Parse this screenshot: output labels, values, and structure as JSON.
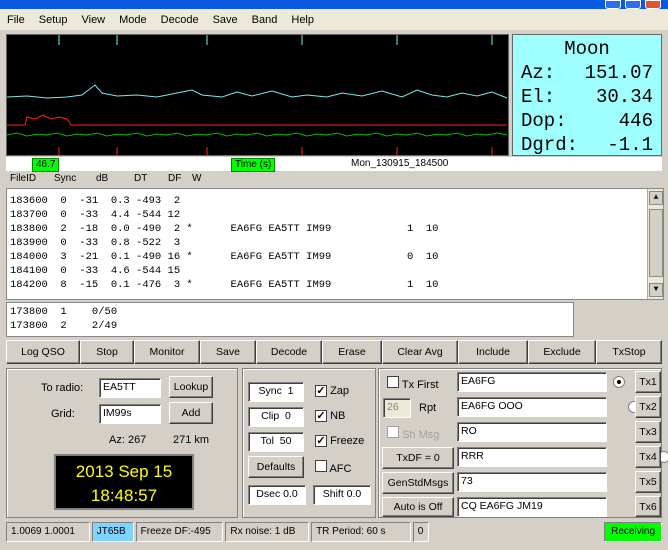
{
  "menu": [
    "File",
    "Setup",
    "View",
    "Mode",
    "Decode",
    "Save",
    "Band",
    "Help"
  ],
  "moon": {
    "title": "Moon",
    "az_label": "Az:",
    "az": "151.07",
    "el_label": "El:",
    "el": "30.34",
    "dop_label": "Dop:",
    "dop": "446",
    "dgrd_label": "Dgrd:",
    "dgrd": "-1.1"
  },
  "scale": {
    "left_value": "46.7",
    "time_label": "Time (s)",
    "filename": "Mon_130915_184500"
  },
  "decode_header": {
    "fileid": "FileID",
    "sync": "Sync",
    "db": "dB",
    "dt": "DT",
    "df": "DF",
    "w": "W"
  },
  "decode_lines": [
    "183600  0  -31  0.3 -493  2",
    "183700  0  -33  4.4 -544 12",
    "183800  2  -18  0.0 -490  2 *      EA6FG EA5TT IM99            1  10",
    "183900  0  -33  0.8 -522  3",
    "184000  3  -21  0.1 -490 16 *      EA6FG EA5TT IM99            0  10",
    "184100  0  -33  4.6 -544 15",
    "184200  8  -15  0.1 -476  3 *      EA6FG EA5TT IM99            1  10"
  ],
  "avg_lines": [
    "173800  1    0/50",
    "173800  2    2/49"
  ],
  "buttons": [
    "Log QSO",
    "Stop",
    "Monitor",
    "Save",
    "Decode",
    "Erase",
    "Clear Avg",
    "Include",
    "Exclude",
    "TxStop"
  ],
  "radio": {
    "to_radio_label": "To radio:",
    "to_radio_value": "EA5TT",
    "grid_label": "Grid:",
    "grid_value": "IM99s",
    "lookup": "Lookup",
    "add": "Add",
    "az": "Az: 267",
    "km": "271 km"
  },
  "clock": {
    "date": "2013 Sep 15",
    "time": "18:48:57"
  },
  "controls": {
    "sync_label": "Sync",
    "sync": "1",
    "clip_label": "Clip",
    "clip": "0",
    "tol_label": "Tol",
    "tol": "50",
    "defaults": "Defaults",
    "dsec": "Dsec  0.0",
    "shift": "Shift 0.0",
    "zap": "Zap",
    "nb": "NB",
    "freeze": "Freeze",
    "afc": "AFC"
  },
  "tx": {
    "tx_first": "Tx First",
    "rpt_value": "26",
    "rpt_label": "Rpt",
    "sh_msg": "Sh Msg",
    "txdf": "TxDF = 0",
    "gen": "GenStdMsgs",
    "auto": "Auto is Off",
    "messages": [
      "EA6FG",
      "EA6FG OOO",
      "RO",
      "RRR",
      "73",
      "CQ EA6FG JM19"
    ],
    "tx_buttons": [
      "Tx1",
      "Tx2",
      "Tx3",
      "Tx4",
      "Tx5",
      "Tx6"
    ]
  },
  "status": {
    "freq": "1.0069 1.0001",
    "mode": "JT65B",
    "freeze": "Freeze DF:-495",
    "rxnoise": "Rx noise:  1 dB",
    "trperiod": "TR Period: 60 s",
    "zero": "0",
    "receiving": "Receiving"
  },
  "colors": {
    "moon_bg": "#9fffff",
    "graph_bg": "#000000",
    "trace_cyan": "#7fe8e8",
    "trace_green": "#00c000",
    "trace_red": "#ff2020",
    "status_green": "#00ff00"
  }
}
